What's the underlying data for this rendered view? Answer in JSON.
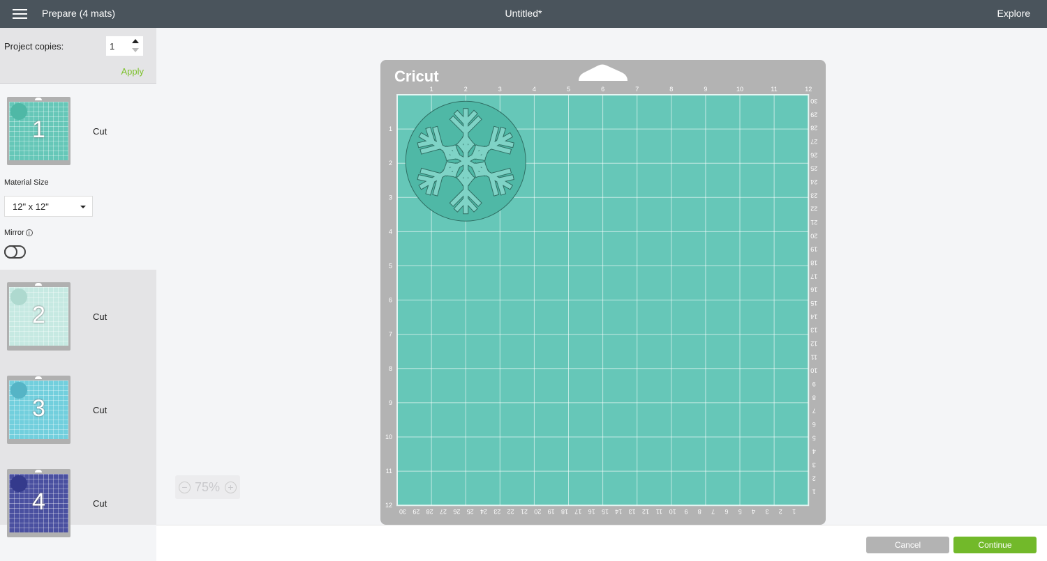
{
  "topbar": {
    "title": "Prepare (4 mats)",
    "project": "Untitled*",
    "machine": "Explore"
  },
  "sidebar": {
    "copies_label": "Project copies:",
    "copies_value": "1",
    "apply_label": "Apply",
    "material_size_label": "Material Size",
    "material_size_value": "12\" x 12\"",
    "mirror_label": "Mirror",
    "mirror_on": false,
    "mats": [
      {
        "number": "1",
        "label": "Cut",
        "color": "#66c7b8",
        "circle": "#4fb8a6"
      },
      {
        "number": "2",
        "label": "Cut",
        "color": "#c6e9e2",
        "circle": "#aed9cf"
      },
      {
        "number": "3",
        "label": "Cut",
        "color": "#72cfdd",
        "circle": "#55b4c6"
      },
      {
        "number": "4",
        "label": "Cut",
        "color": "#4a50a0",
        "circle": "#343a8c"
      }
    ]
  },
  "canvas": {
    "mat_brand": "Cricut",
    "mat_color": "#66c7b8",
    "design_color": "#4fb8a6",
    "top_ruler": [
      "1",
      "2",
      "3",
      "4",
      "5",
      "6",
      "7",
      "8",
      "9",
      "10",
      "11",
      "12"
    ],
    "left_ruler": [
      "1",
      "2",
      "3",
      "4",
      "5",
      "6",
      "7",
      "8",
      "9",
      "10",
      "11",
      "12"
    ],
    "right_ruler": [
      "30",
      "29",
      "28",
      "27",
      "26",
      "25",
      "24",
      "23",
      "22",
      "21",
      "20",
      "19",
      "18",
      "17",
      "16",
      "15",
      "14",
      "13",
      "12",
      "11",
      "10",
      "9",
      "8",
      "7",
      "6",
      "5",
      "4",
      "3",
      "2",
      "1"
    ],
    "bottom_ruler": [
      "30",
      "29",
      "28",
      "27",
      "26",
      "25",
      "24",
      "23",
      "22",
      "21",
      "20",
      "19",
      "18",
      "17",
      "16",
      "15",
      "14",
      "13",
      "12",
      "11",
      "10",
      "9",
      "8",
      "7",
      "6",
      "5",
      "4",
      "3",
      "2",
      "1"
    ],
    "zoom": "75%"
  },
  "footer": {
    "cancel": "Cancel",
    "continue": "Continue"
  }
}
